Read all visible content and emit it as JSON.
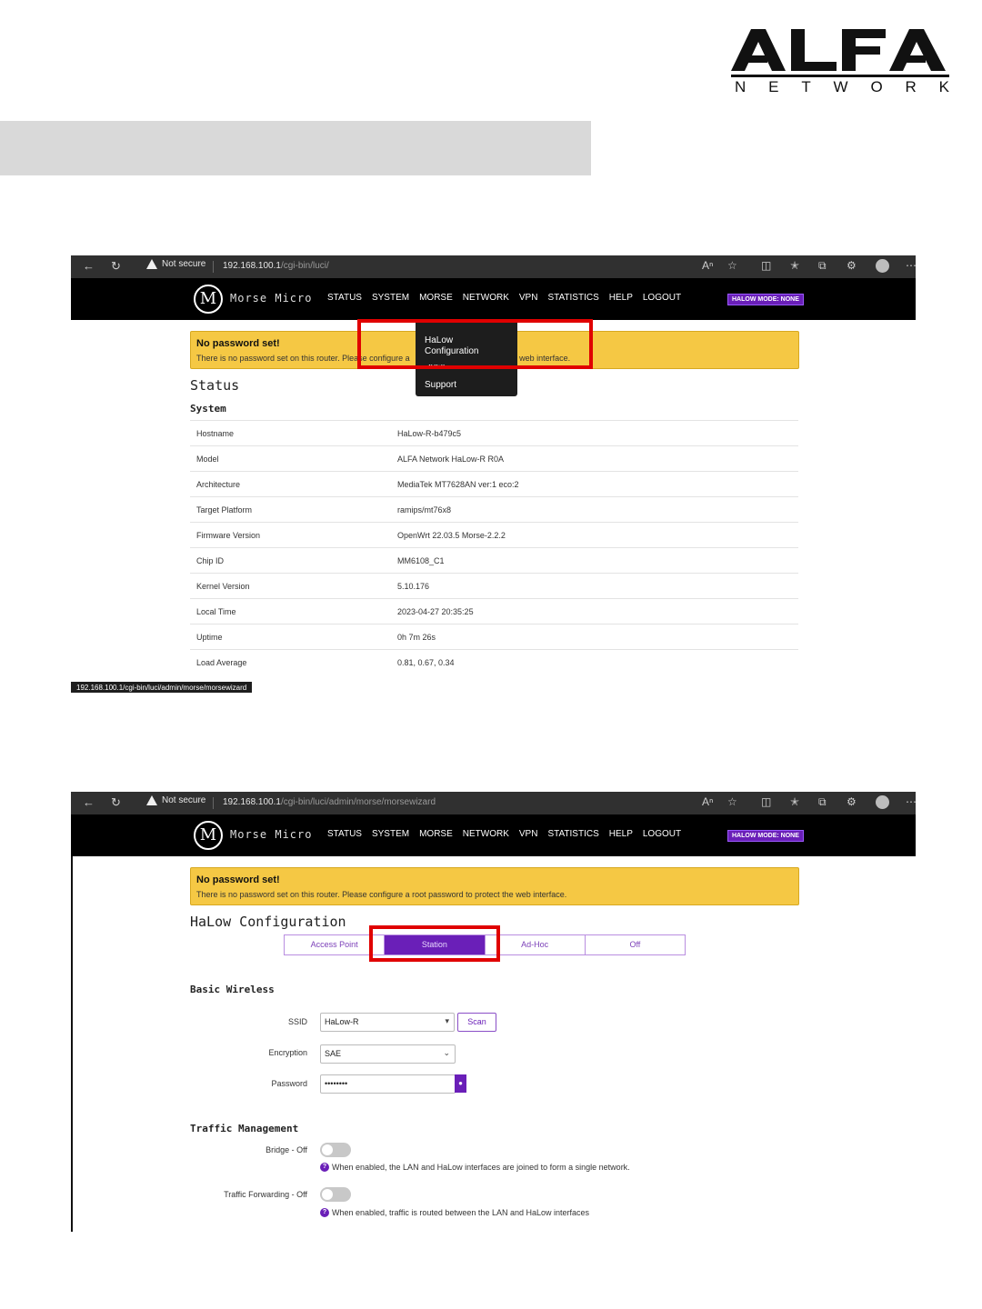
{
  "brand": {
    "logo_text": "ALFA",
    "logo_sub": "NETWORK",
    "sub_letters": [
      "N",
      "E",
      "T",
      "W",
      "O",
      "R",
      "K"
    ]
  },
  "shot1": {
    "browser": {
      "warning": "Not secure",
      "url_host": "192.168.100.1",
      "url_path": "/cgi-bin/luci/"
    },
    "app": {
      "logo_letter": "M",
      "brand": "Morse Micro",
      "nav": [
        "STATUS",
        "SYSTEM",
        "MORSE",
        "NETWORK",
        "VPN",
        "STATISTICS",
        "HELP",
        "LOGOUT"
      ],
      "halow_mode": "HALOW MODE: NONE"
    },
    "alert": {
      "title": "No password set!",
      "text_left": "There is no password set on this router. Ple",
      "text_mid": "ase configure a",
      "text_right": "e web interface."
    },
    "dropdown": {
      "items": [
        "HaLow",
        "Configuration",
        "Shell",
        "Support"
      ]
    },
    "heading": "Status",
    "subheading": "System",
    "rows": [
      {
        "k": "Hostname",
        "v": "HaLow-R-b479c5"
      },
      {
        "k": "Model",
        "v": "ALFA Network HaLow-R R0A"
      },
      {
        "k": "Architecture",
        "v": "MediaTek MT7628AN ver:1 eco:2"
      },
      {
        "k": "Target Platform",
        "v": "ramips/mt76x8"
      },
      {
        "k": "Firmware Version",
        "v": "OpenWrt 22.03.5 Morse-2.2.2"
      },
      {
        "k": "Chip ID",
        "v": "MM6108_C1"
      },
      {
        "k": "Kernel Version",
        "v": "5.10.176"
      },
      {
        "k": "Local Time",
        "v": "2023-04-27 20:35:25"
      },
      {
        "k": "Uptime",
        "v": "0h 7m 26s"
      },
      {
        "k": "Load Average",
        "v": "0.81, 0.67, 0.34"
      }
    ],
    "status_url": "192.168.100.1/cgi-bin/luci/admin/morse/morsewizard"
  },
  "shot2": {
    "browser": {
      "warning": "Not secure",
      "url_host": "192.168.100.1",
      "url_path": "/cgi-bin/luci/admin/morse/morsewizard"
    },
    "alert": {
      "title": "No password set!",
      "text": "There is no password set on this router. Please configure a root password to protect the web interface."
    },
    "heading": "HaLow Configuration",
    "modes": [
      "Access Point",
      "Station",
      "Ad-Hoc",
      "Off"
    ],
    "active_mode": "Station",
    "basic_wireless": "Basic Wireless",
    "ssid_label": "SSID",
    "ssid_value": "HaLow-R",
    "scan_label": "Scan",
    "encryption_label": "Encryption",
    "encryption_value": "SAE",
    "password_label": "Password",
    "password_value": "••••••••",
    "traffic": "Traffic Management",
    "bridge_label": "Bridge - Off",
    "bridge_help": "When enabled, the LAN and HaLow interfaces are joined to form a single network.",
    "forward_label": "Traffic Forwarding - Off",
    "forward_help": "When enabled, traffic is routed between the LAN and HaLow interfaces"
  },
  "colors": {
    "accent": "#6a1fb8",
    "alert": "#f5c844",
    "highlight": "#e00000"
  }
}
